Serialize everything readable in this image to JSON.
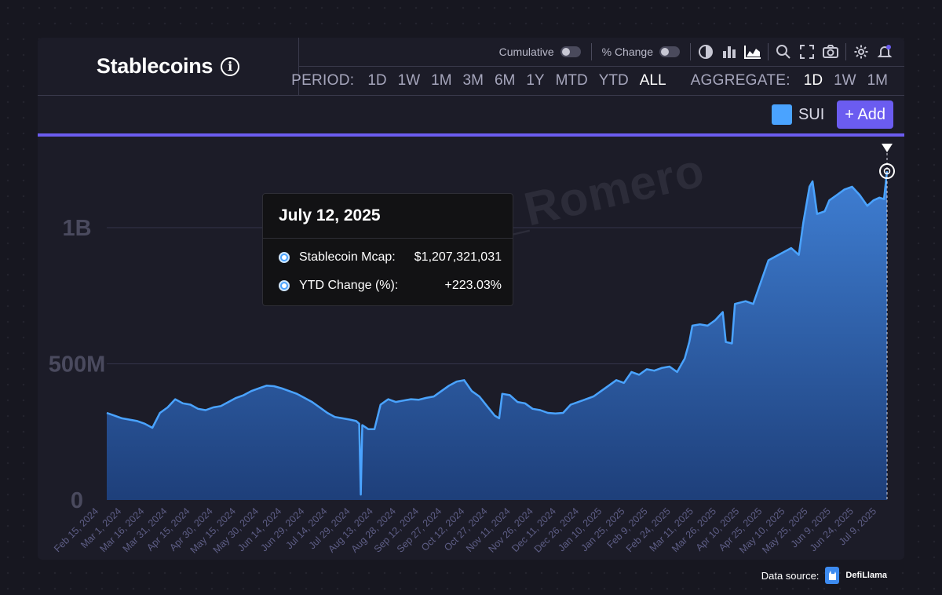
{
  "header": {
    "title": "Stablecoins",
    "info_icon": "info-icon"
  },
  "toolbar": {
    "cumulative_label": "Cumulative",
    "pct_change_label": "% Change",
    "icons": [
      "pie-chart-icon",
      "bar-chart-icon",
      "area-chart-icon",
      "search-icon",
      "fullscreen-icon",
      "camera-icon",
      "gear-icon",
      "bell-icon"
    ]
  },
  "period": {
    "label": "PERIOD:",
    "options": [
      "1D",
      "1W",
      "1M",
      "3M",
      "6M",
      "1Y",
      "MTD",
      "YTD",
      "ALL"
    ],
    "active": "ALL",
    "aggregate_label": "AGGREGATE:",
    "aggregate_options": [
      "1D",
      "1W",
      "1M"
    ],
    "aggregate_active": "1D"
  },
  "legend": {
    "label": "SUI",
    "color": "#4aa3ff",
    "add_label": "+ Add"
  },
  "tooltip": {
    "date": "July 12, 2025",
    "rows": [
      {
        "label": "Stablecoin Mcap:",
        "value": "$1,207,321,031"
      },
      {
        "label": "YTD Change (%):",
        "value": "+223.03%"
      }
    ]
  },
  "watermark": "𝕏 Torero_Romero",
  "footer": {
    "data_source_label": "Data source:",
    "brand": "DefiLlama"
  },
  "chart_data": {
    "type": "area",
    "series_name": "SUI",
    "ylim": [
      0,
      1300000000
    ],
    "ytick_values": [
      0,
      500000000,
      1000000000
    ],
    "ytick_labels": [
      "0",
      "500M",
      "1B"
    ],
    "x_ticks": [
      "Feb 15, 2024",
      "Mar 1, 2024",
      "Mar 16, 2024",
      "Mar 31, 2024",
      "Apr 15, 2024",
      "Apr 30, 2024",
      "May 15, 2024",
      "May 30, 2024",
      "Jun 14, 2024",
      "Jun 29, 2024",
      "Jul 14, 2024",
      "Jul 29, 2024",
      "Aug 13, 2024",
      "Aug 28, 2024",
      "Sep 12, 2024",
      "Sep 27, 2024",
      "Oct 12, 2024",
      "Oct 27, 2024",
      "Nov 11, 2024",
      "Nov 26, 2024",
      "Dec 11, 2024",
      "Dec 26, 2024",
      "Jan 10, 2025",
      "Jan 25, 2025",
      "Feb 9, 2025",
      "Feb 24, 2025",
      "Mar 11, 2025",
      "Mar 26, 2025",
      "Apr 10, 2025",
      "Apr 25, 2025",
      "May 10, 2025",
      "May 25, 2025",
      "Jun 9, 2025",
      "Jun 24, 2025",
      "Jul 9, 2025"
    ],
    "x_start": "2024-02-15",
    "x_end": "2025-07-12",
    "points": [
      [
        "2024-02-15",
        320000000
      ],
      [
        "2024-02-20",
        310000000
      ],
      [
        "2024-02-25",
        300000000
      ],
      [
        "2024-03-01",
        295000000
      ],
      [
        "2024-03-06",
        290000000
      ],
      [
        "2024-03-11",
        280000000
      ],
      [
        "2024-03-16",
        265000000
      ],
      [
        "2024-03-21",
        320000000
      ],
      [
        "2024-03-26",
        340000000
      ],
      [
        "2024-03-31",
        370000000
      ],
      [
        "2024-04-05",
        355000000
      ],
      [
        "2024-04-10",
        350000000
      ],
      [
        "2024-04-15",
        335000000
      ],
      [
        "2024-04-20",
        330000000
      ],
      [
        "2024-04-25",
        340000000
      ],
      [
        "2024-04-30",
        345000000
      ],
      [
        "2024-05-05",
        360000000
      ],
      [
        "2024-05-10",
        375000000
      ],
      [
        "2024-05-15",
        385000000
      ],
      [
        "2024-05-20",
        400000000
      ],
      [
        "2024-05-25",
        410000000
      ],
      [
        "2024-05-30",
        420000000
      ],
      [
        "2024-06-04",
        418000000
      ],
      [
        "2024-06-09",
        410000000
      ],
      [
        "2024-06-14",
        400000000
      ],
      [
        "2024-06-19",
        390000000
      ],
      [
        "2024-06-24",
        375000000
      ],
      [
        "2024-06-29",
        360000000
      ],
      [
        "2024-07-04",
        340000000
      ],
      [
        "2024-07-09",
        320000000
      ],
      [
        "2024-07-14",
        305000000
      ],
      [
        "2024-07-19",
        300000000
      ],
      [
        "2024-07-24",
        295000000
      ],
      [
        "2024-07-28",
        290000000
      ],
      [
        "2024-07-30",
        280000000
      ],
      [
        "2024-07-31",
        20000000
      ],
      [
        "2024-08-01",
        275000000
      ],
      [
        "2024-08-05",
        260000000
      ],
      [
        "2024-08-09",
        260000000
      ],
      [
        "2024-08-13",
        350000000
      ],
      [
        "2024-08-18",
        370000000
      ],
      [
        "2024-08-23",
        360000000
      ],
      [
        "2024-08-28",
        365000000
      ],
      [
        "2024-09-02",
        370000000
      ],
      [
        "2024-09-07",
        368000000
      ],
      [
        "2024-09-12",
        375000000
      ],
      [
        "2024-09-17",
        380000000
      ],
      [
        "2024-09-22",
        400000000
      ],
      [
        "2024-09-27",
        420000000
      ],
      [
        "2024-10-02",
        435000000
      ],
      [
        "2024-10-07",
        440000000
      ],
      [
        "2024-10-12",
        400000000
      ],
      [
        "2024-10-17",
        380000000
      ],
      [
        "2024-10-22",
        345000000
      ],
      [
        "2024-10-27",
        310000000
      ],
      [
        "2024-10-30",
        300000000
      ],
      [
        "2024-11-01",
        390000000
      ],
      [
        "2024-11-06",
        385000000
      ],
      [
        "2024-11-11",
        360000000
      ],
      [
        "2024-11-16",
        355000000
      ],
      [
        "2024-11-21",
        335000000
      ],
      [
        "2024-11-26",
        330000000
      ],
      [
        "2024-12-01",
        320000000
      ],
      [
        "2024-12-06",
        318000000
      ],
      [
        "2024-12-11",
        320000000
      ],
      [
        "2024-12-16",
        350000000
      ],
      [
        "2024-12-21",
        360000000
      ],
      [
        "2024-12-26",
        370000000
      ],
      [
        "2024-12-31",
        380000000
      ],
      [
        "2025-01-05",
        400000000
      ],
      [
        "2025-01-10",
        420000000
      ],
      [
        "2025-01-15",
        440000000
      ],
      [
        "2025-01-20",
        430000000
      ],
      [
        "2025-01-25",
        470000000
      ],
      [
        "2025-01-30",
        460000000
      ],
      [
        "2025-02-04",
        480000000
      ],
      [
        "2025-02-09",
        475000000
      ],
      [
        "2025-02-14",
        485000000
      ],
      [
        "2025-02-19",
        490000000
      ],
      [
        "2025-02-24",
        470000000
      ],
      [
        "2025-03-01",
        520000000
      ],
      [
        "2025-03-04",
        580000000
      ],
      [
        "2025-03-06",
        640000000
      ],
      [
        "2025-03-11",
        645000000
      ],
      [
        "2025-03-16",
        640000000
      ],
      [
        "2025-03-21",
        660000000
      ],
      [
        "2025-03-26",
        690000000
      ],
      [
        "2025-03-28",
        580000000
      ],
      [
        "2025-04-01",
        575000000
      ],
      [
        "2025-04-03",
        720000000
      ],
      [
        "2025-04-10",
        730000000
      ],
      [
        "2025-04-15",
        720000000
      ],
      [
        "2025-04-20",
        800000000
      ],
      [
        "2025-04-25",
        880000000
      ],
      [
        "2025-04-30",
        895000000
      ],
      [
        "2025-05-05",
        910000000
      ],
      [
        "2025-05-10",
        925000000
      ],
      [
        "2025-05-15",
        900000000
      ],
      [
        "2025-05-18",
        1020000000
      ],
      [
        "2025-05-22",
        1150000000
      ],
      [
        "2025-05-24",
        1170000000
      ],
      [
        "2025-05-27",
        1050000000
      ],
      [
        "2025-06-01",
        1060000000
      ],
      [
        "2025-06-04",
        1100000000
      ],
      [
        "2025-06-09",
        1120000000
      ],
      [
        "2025-06-14",
        1140000000
      ],
      [
        "2025-06-19",
        1150000000
      ],
      [
        "2025-06-24",
        1120000000
      ],
      [
        "2025-06-29",
        1080000000
      ],
      [
        "2025-07-03",
        1100000000
      ],
      [
        "2025-07-07",
        1110000000
      ],
      [
        "2025-07-10",
        1105000000
      ],
      [
        "2025-07-12",
        1207321031
      ]
    ],
    "line_color": "#4aa3ff",
    "fill_top_color": "#3f7fd4",
    "fill_bottom_color": "#1e3f7a",
    "grid": true,
    "legend_position": "top-right"
  }
}
